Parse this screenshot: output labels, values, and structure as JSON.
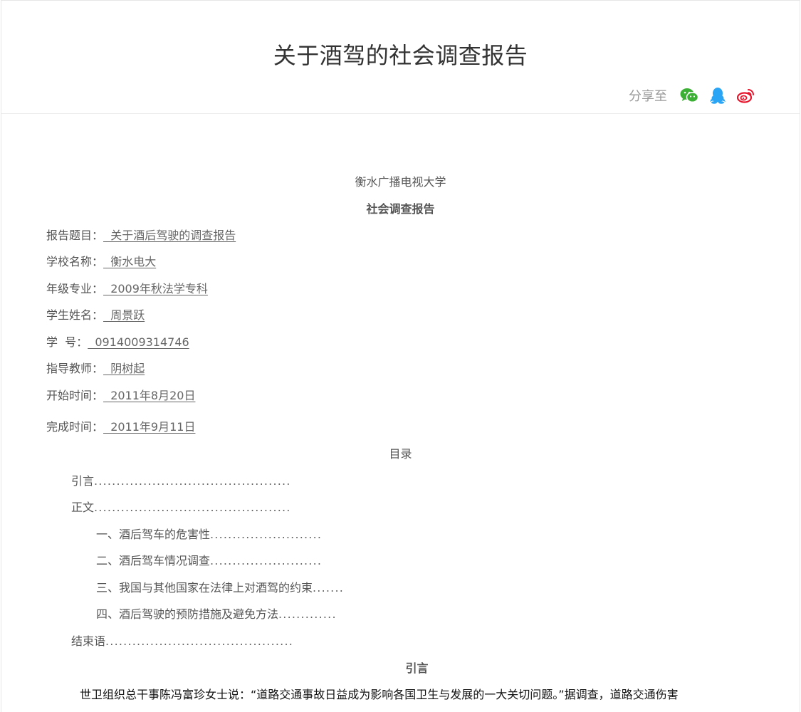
{
  "header": {
    "title": "关于酒驾的社会调查报告",
    "share_label": "分享至",
    "share_icons": [
      "wechat-icon",
      "qq-icon",
      "weibo-icon"
    ],
    "colors": {
      "wechat": "#3cb034",
      "qq": "#2aa4f4",
      "weibo": "#e6162d"
    }
  },
  "document": {
    "university": "衡水广播电视大学",
    "report_type": "社会调查报告",
    "fields": [
      {
        "label": "报告题目：",
        "value": "  关于酒后驾驶的调查报告"
      },
      {
        "label": "学校名称：",
        "value": "  衡水电大"
      },
      {
        "label": "年级专业：",
        "value": "  2009年秋法学专科"
      },
      {
        "label": "学生姓名：",
        "value": "  周景跃"
      },
      {
        "label": "学  号：",
        "value": "  0914009314746"
      },
      {
        "label": "指导教师：",
        "value": "  阴树起"
      },
      {
        "label": "开始时间：",
        "value": "  2011年8月20日"
      },
      {
        "label": "完成时间：",
        "value": "  2011年9月11日"
      }
    ],
    "toc_title": "目录",
    "toc": [
      {
        "text": "引言",
        "dots": "............................................"
      },
      {
        "text": "正文",
        "dots": "............................................"
      },
      {
        "text": "一、酒后驾车的危害性",
        "dots": "........................."
      },
      {
        "text": "二、酒后驾车情况调查",
        "dots": "........................."
      },
      {
        "text": "三、我国与其他国家在法律上对酒驾的约束",
        "dots": "......."
      },
      {
        "text": "四、酒后驾驶的预防措施及避免方法",
        "dots": "............."
      },
      {
        "text": "结束语",
        "dots": ".........................................."
      }
    ],
    "intro_heading": "引言",
    "intro_paragraph": "世卫组织总干事陈冯富珍女士说：“道路交通事故日益成为影响各国卫生与发展的一大关切问题。”据调查，道路交通伤害"
  }
}
